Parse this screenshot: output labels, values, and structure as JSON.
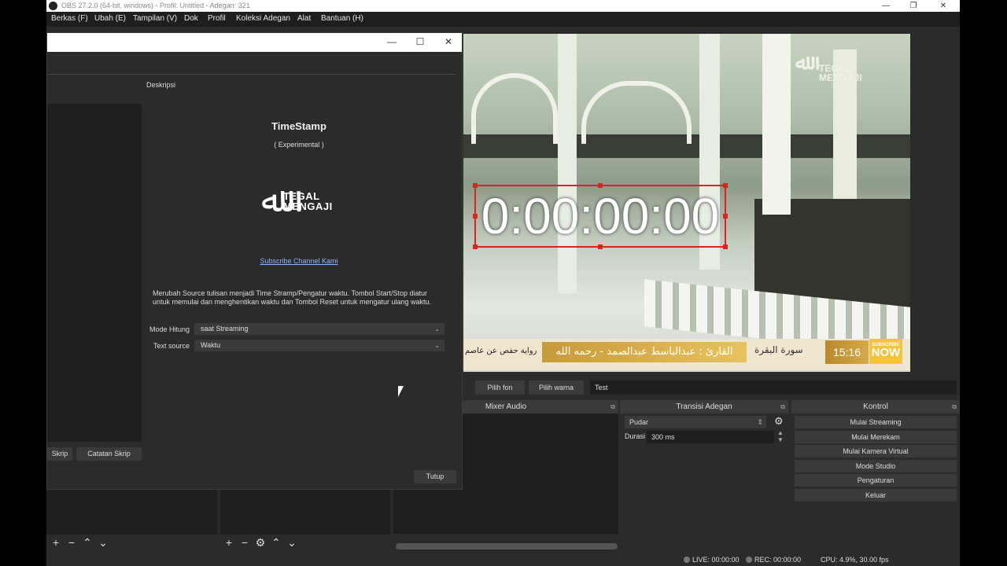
{
  "window": {
    "title": "OBS 27.2.0 (64-bit, windows) - Profil: Untitled - Adegan: 321"
  },
  "menu": [
    "Berkas (F)",
    "Ubah (E)",
    "Tampilan (V)",
    "Dok",
    "Profil",
    "Koleksi Adegan",
    "Alat",
    "Bantuan (H)"
  ],
  "dialog": {
    "description_label": "Deskripsi",
    "script_title": "TimeStamp",
    "script_subtitle": "( Experimental )",
    "logo_line1": "TEGAL",
    "logo_line2": "MENGAJI",
    "link_text": "Subscribe Channel Kami",
    "paragraph": "Merubah Source tulisan menjadi Time Stramp/Pengatur waktu. Tombol Start/Stop diatur untuk memulai dan menghentikan waktu dan Tombol Reset untuk mengatur ulang waktu.",
    "mode_label": "Mode Hitung",
    "mode_value": "saat Streaming",
    "source_label": "Text source",
    "source_value": "Waktu",
    "btn_skrip": "Skrip",
    "btn_log": "Catatan Skrip",
    "btn_close": "Tutup"
  },
  "preview": {
    "timer": "0:00:00:00",
    "logo_l1": "TEGAL",
    "logo_l2": "MENGAJI",
    "ticker_main": "القارئ : عبدالباسط عبدالصمد - رحمه الله",
    "ticker_surah": "سورة البقرة",
    "ticker_riwayah": "رواية حفص عن عاصم",
    "clock": "15:16",
    "badge_top": "SUBSCRIBE",
    "badge_now": "NOW"
  },
  "text_toolbar": {
    "font_btn": "Pilih fon",
    "color_btn": "Pilih warna",
    "text_value": "Test"
  },
  "docks": {
    "mixer_title": "Mixer Audio",
    "transition_title": "Transisi Adegan",
    "transition_value": "Pudar",
    "duration_label": "Durasi",
    "duration_value": "300 ms",
    "controls_title": "Kontrol",
    "controls": [
      "Mulai Streaming",
      "Mulai Merekam",
      "Mulai Kamera Virtual",
      "Mode Studio",
      "Pengaturan",
      "Keluar"
    ]
  },
  "status": {
    "live": "LIVE: 00:00:00",
    "rec": "REC: 00:00:00",
    "cpu": "CPU: 4.9%, 30.00 fps"
  },
  "colors": {
    "selection": "#d22222",
    "link": "#8fb4ff",
    "ticker_gold": "#c79a3c"
  }
}
